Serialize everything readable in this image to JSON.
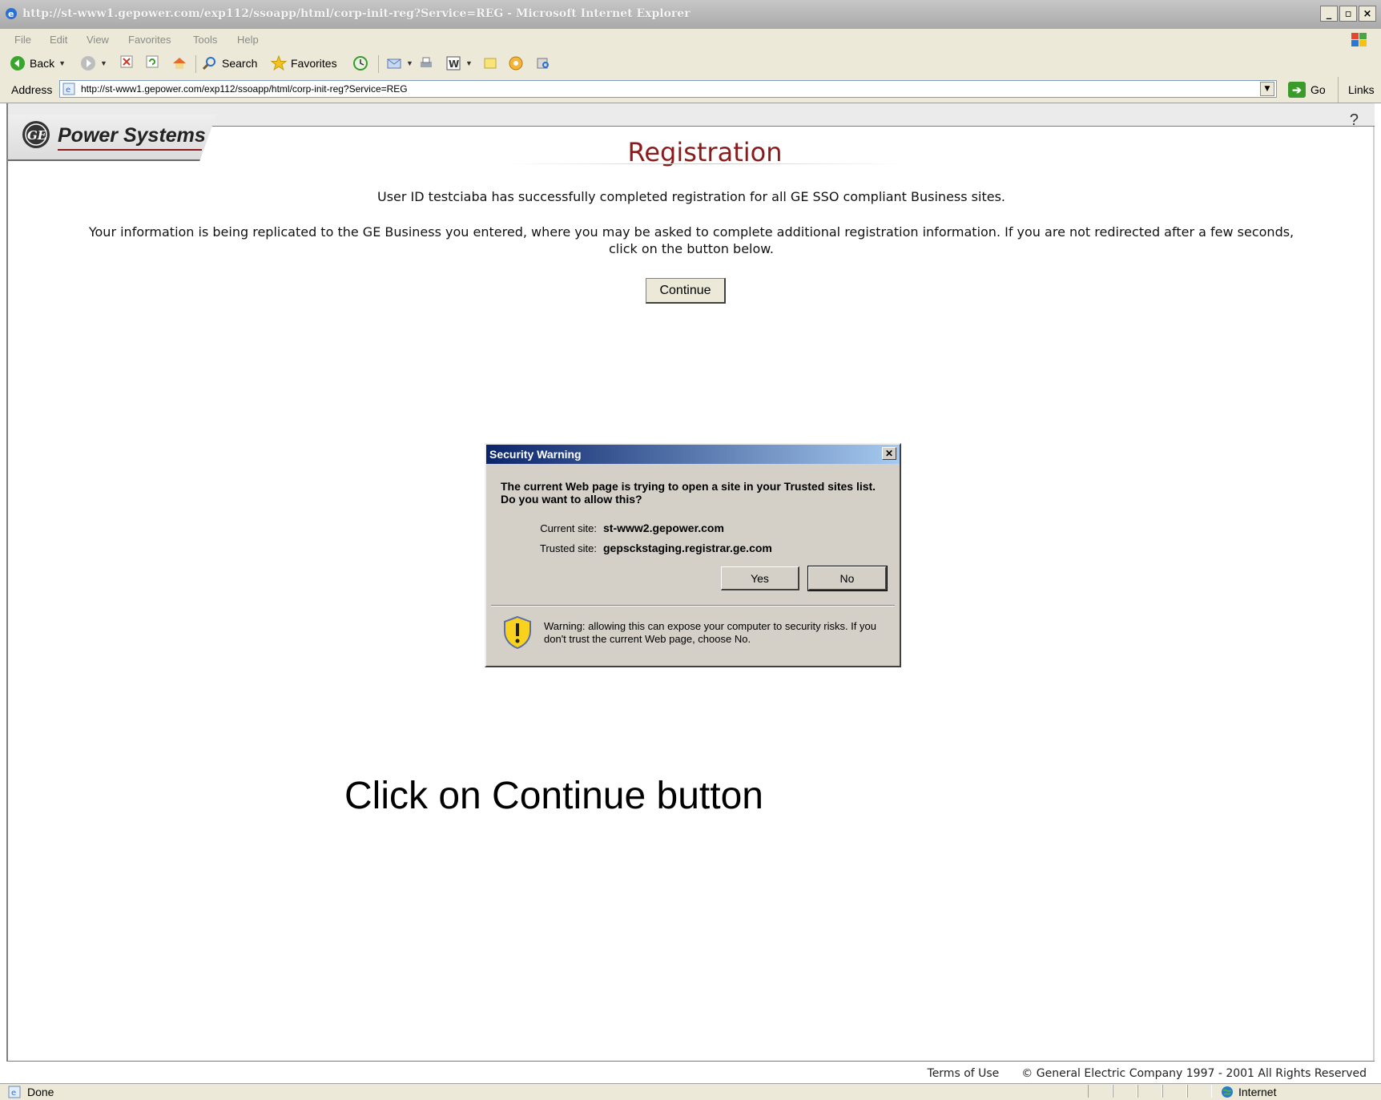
{
  "window": {
    "title": "http://st-www1.gepower.com/exp112/ssoapp/html/corp-init-reg?Service=REG - Microsoft Internet Explorer",
    "controls": {
      "minimize": "_",
      "maximize": "▫",
      "close": "×"
    }
  },
  "menu": [
    "File",
    "Edit",
    "View",
    "Favorites",
    "Tools",
    "Help"
  ],
  "toolbar": {
    "back_label": "Back",
    "search_label": "Search",
    "favorites_label": "Favorites"
  },
  "address": {
    "label": "Address",
    "url": "http://st-www1.gepower.com/exp112/ssoapp/html/corp-init-reg?Service=REG",
    "go_label": "Go",
    "links_label": "Links"
  },
  "page": {
    "brand": "Power Systems",
    "help": "?",
    "title": "Registration",
    "success_message": "User ID testciaba has successfully completed registration for all GE SSO compliant Business sites.",
    "replication_line1": "Your information is being replicated to the GE Business you entered, where you may be asked to complete additional registration information. If you are not redirected after a few seconds,",
    "replication_line2": "click on the button below.",
    "continue_label": "Continue",
    "footer_terms": "Terms of Use",
    "footer_copyright": "© General Electric Company 1997 - 2001 All Rights Reserved"
  },
  "dialog": {
    "title": "Security Warning",
    "question": "The current Web page is trying to open a site in your Trusted sites list. Do you want to allow this?",
    "current_site_label": "Current site:",
    "current_site_value": "st-www2.gepower.com",
    "trusted_site_label": "Trusted site:",
    "trusted_site_value": "gepsckstaging.registrar.ge.com",
    "yes_label": "Yes",
    "no_label": "No",
    "warning_text": "Warning: allowing this can expose your computer to security risks. If you don't trust the current Web page, choose No."
  },
  "annotation": {
    "instruction": "Click on Continue button"
  },
  "status": {
    "text": "Done",
    "zone": "Internet"
  },
  "icons": [
    "ie-icon",
    "back-icon",
    "forward-icon",
    "stop-icon",
    "refresh-icon",
    "home-icon",
    "search-icon",
    "favorites-star-icon",
    "history-icon",
    "mail-icon",
    "print-icon",
    "word-icon",
    "note-icon",
    "messenger-icon",
    "research-icon",
    "ge-logo-icon",
    "warning-shield-icon",
    "internet-globe-icon"
  ]
}
